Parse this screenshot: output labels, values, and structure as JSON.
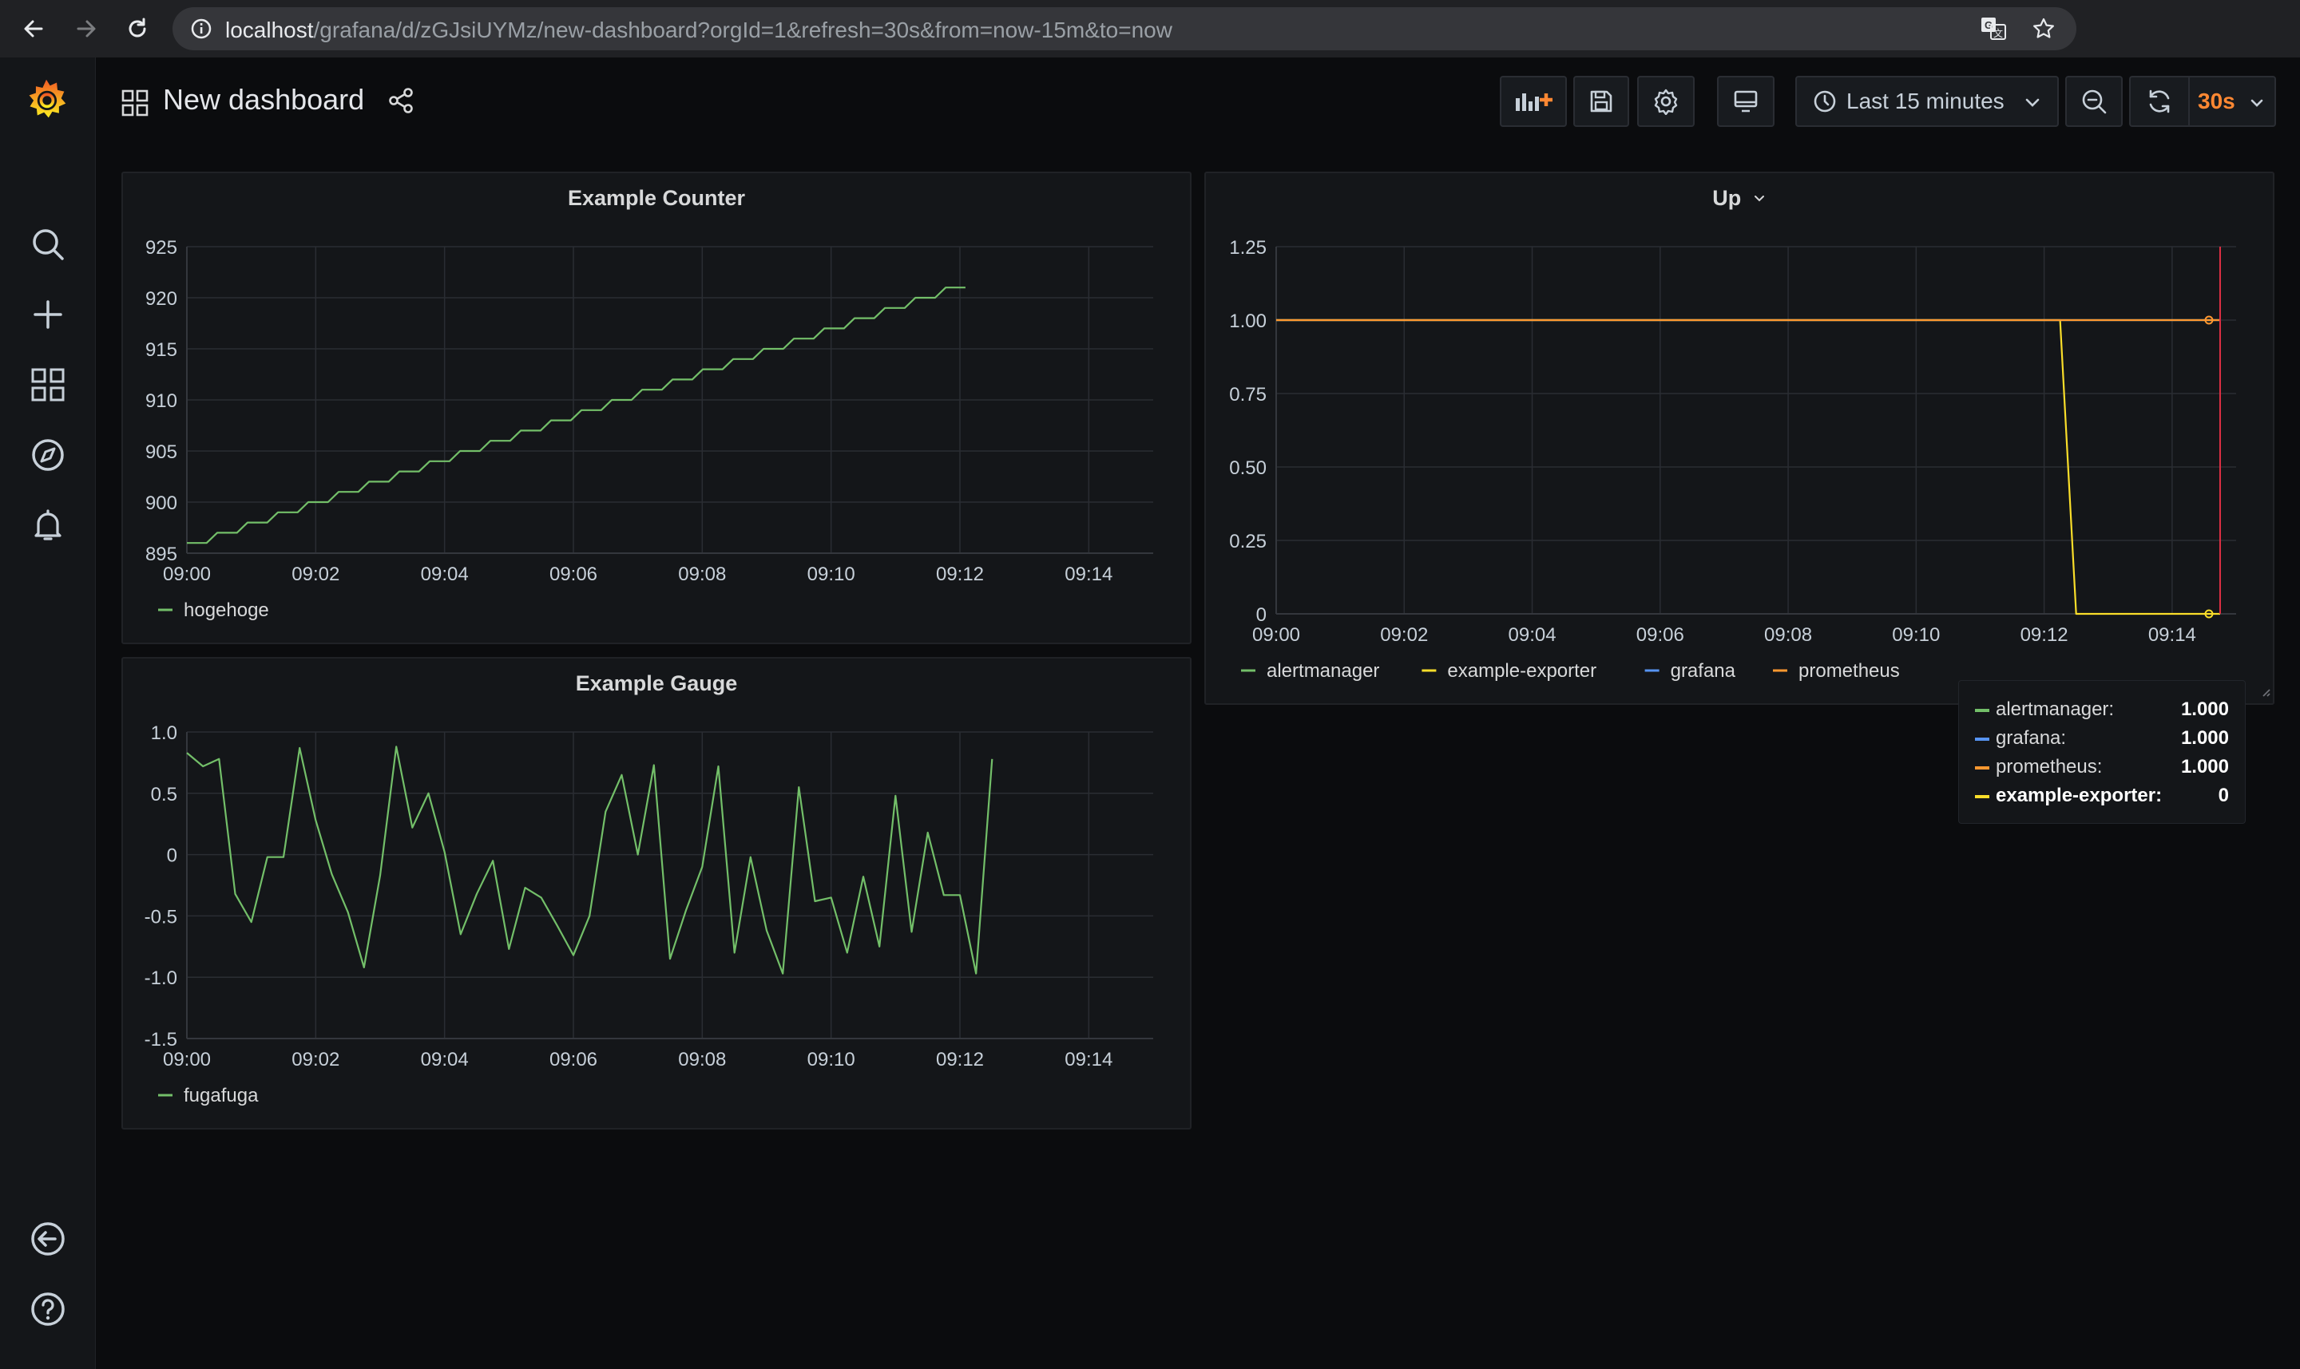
{
  "browser": {
    "url_host": "localhost",
    "url_path": "/grafana/d/zGJsiUYMz/new-dashboard?orgId=1&refresh=30s&from=now-15m&to=now"
  },
  "sidebar": {
    "items": [
      {
        "icon": "grafana-logo-icon"
      },
      {
        "icon": "search-icon"
      },
      {
        "icon": "plus-icon"
      },
      {
        "icon": "dashboards-icon"
      },
      {
        "icon": "explore-compass-icon"
      },
      {
        "icon": "alerting-bell-icon"
      },
      {
        "icon": "sign-in-icon"
      },
      {
        "icon": "help-icon"
      }
    ]
  },
  "header": {
    "title": "New dashboard",
    "time_range": "Last 15 minutes",
    "refresh_interval": "30s"
  },
  "colors": {
    "green": "#73bf69",
    "yellow": "#fade2a",
    "blue": "#5794f2",
    "orange": "#ff9830",
    "accent": "#ff8833",
    "threshold_red": "#e02f44"
  },
  "panels": [
    {
      "title": "Example Counter",
      "legend": [
        "hogehoge"
      ]
    },
    {
      "title": "Example Gauge",
      "legend": [
        "fugafuga"
      ]
    },
    {
      "title": "Up",
      "legend": [
        "alertmanager",
        "example-exporter",
        "grafana",
        "prometheus"
      ]
    }
  ],
  "tooltip": {
    "rows": [
      {
        "name": "alertmanager:",
        "value": "1.000",
        "color": "#73bf69"
      },
      {
        "name": "grafana:",
        "value": "1.000",
        "color": "#5794f2"
      },
      {
        "name": "prometheus:",
        "value": "1.000",
        "color": "#ff9830"
      },
      {
        "name": "example-exporter:",
        "value": "0",
        "color": "#fade2a",
        "bold": true
      }
    ]
  },
  "chart_data": [
    {
      "type": "line",
      "title": "Example Counter",
      "x_start": "09:00",
      "x_end": "09:15",
      "x_ticks": [
        "09:00",
        "09:02",
        "09:04",
        "09:06",
        "09:08",
        "09:10",
        "09:12",
        "09:14"
      ],
      "y_ticks": [
        "895",
        "900",
        "905",
        "910",
        "915",
        "920",
        "925"
      ],
      "ylim": [
        895,
        925
      ],
      "series": [
        {
          "name": "hogehoge",
          "color": "#73bf69",
          "x": [
            "09:00",
            "09:12:15"
          ],
          "values_start": 896,
          "values_end": 921,
          "step_shape": true
        }
      ]
    },
    {
      "type": "line",
      "title": "Example Gauge",
      "x_start": "09:00",
      "x_end": "09:15",
      "x_ticks": [
        "09:00",
        "09:02",
        "09:04",
        "09:06",
        "09:08",
        "09:10",
        "09:12",
        "09:14"
      ],
      "y_ticks": [
        "1.0",
        "0.5",
        "0",
        "-0.5",
        "-1.0",
        "-1.5"
      ],
      "ylim": [
        -1.5,
        1.0
      ],
      "series": [
        {
          "name": "fugafuga",
          "color": "#73bf69",
          "x_start": "09:00",
          "x_step_seconds": 15,
          "values": [
            0.83,
            0.72,
            0.78,
            -0.32,
            -0.55,
            -0.02,
            -0.02,
            0.87,
            0.28,
            -0.16,
            -0.47,
            -0.92,
            -0.17,
            0.88,
            0.22,
            0.5,
            0.02,
            -0.65,
            -0.32,
            -0.05,
            -0.77,
            -0.27,
            -0.35,
            -0.58,
            -0.82,
            -0.5,
            0.35,
            0.65,
            0.0,
            0.73,
            -0.85,
            -0.45,
            -0.1,
            0.72,
            -0.8,
            -0.02,
            -0.62,
            -0.97,
            0.55,
            -0.38,
            -0.35,
            -0.8,
            -0.18,
            -0.75,
            0.48,
            -0.63,
            0.18,
            -0.33,
            -0.33,
            -0.97,
            0.78
          ]
        }
      ]
    },
    {
      "type": "line",
      "title": "Up",
      "x_start": "09:00",
      "x_end": "09:15",
      "x_ticks": [
        "09:00",
        "09:02",
        "09:04",
        "09:06",
        "09:08",
        "09:10",
        "09:12",
        "09:14"
      ],
      "y_ticks": [
        "1.25",
        "1.00",
        "0.75",
        "0.50",
        "0.25",
        "0"
      ],
      "ylim": [
        0,
        1.25
      ],
      "series": [
        {
          "name": "alertmanager",
          "color": "#73bf69",
          "points": [
            [
              "09:00",
              1
            ],
            [
              "09:14:45",
              1
            ]
          ]
        },
        {
          "name": "example-exporter",
          "color": "#fade2a",
          "points": [
            [
              "09:00",
              1
            ],
            [
              "09:12:15",
              1
            ],
            [
              "09:12:30",
              0
            ],
            [
              "09:14:45",
              0
            ]
          ]
        },
        {
          "name": "grafana",
          "color": "#5794f2",
          "points": [
            [
              "09:00",
              1
            ],
            [
              "09:14:45",
              1
            ]
          ]
        },
        {
          "name": "prometheus",
          "color": "#ff9830",
          "points": [
            [
              "09:00",
              1
            ],
            [
              "09:14:45",
              1
            ]
          ]
        }
      ],
      "cursor_time": "09:14:45"
    }
  ]
}
